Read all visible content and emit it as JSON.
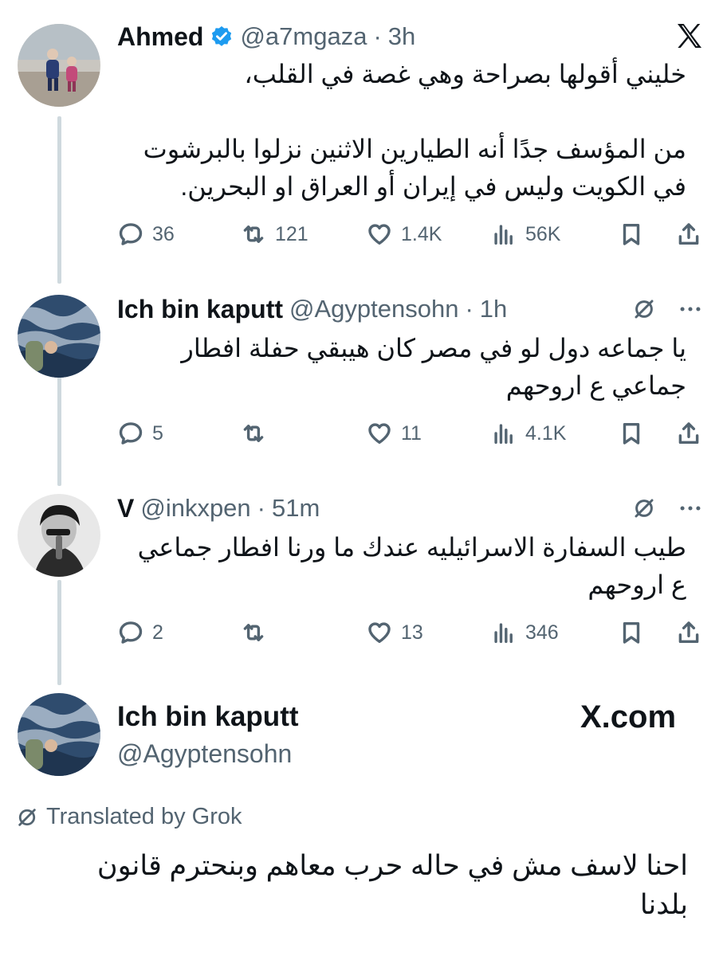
{
  "tweets": [
    {
      "name": "Ahmed",
      "handle": "@a7mgaza",
      "dot": "·",
      "time": "3h",
      "text": "خليني أقولها بصراحة وهي غصة في القلب،\n\nمن المؤسف جدًا أنه الطيارين الاثنين نزلوا بالبرشوت\nفي الكويت وليس في إيران أو العراق او البحرين.",
      "replies": "36",
      "reposts": "121",
      "likes": "1.4K",
      "views": "56K"
    },
    {
      "name": "Ich bin kaputt",
      "handle": "@Agyptensohn",
      "dot": "·",
      "time": "1h",
      "text": "يا جماعه دول لو في مصر كان هيبقي حفلة افطار\nجماعي ع اروحهم",
      "replies": "5",
      "reposts": "",
      "likes": "11",
      "views": "4.1K"
    },
    {
      "name": "V",
      "handle": "@inkxpen",
      "dot": "·",
      "time": "51m",
      "text": "طيب السفارة الاسرائيليه عندك ما ورنا افطار جماعي\nع اروحهم",
      "replies": "2",
      "reposts": "",
      "likes": "13",
      "views": "346"
    }
  ],
  "final": {
    "name": "Ich bin kaputt",
    "handle": "@Agyptensohn",
    "brand": "X.com",
    "translated_label": "Translated by Grok",
    "text": "احنا لاسف مش في حاله حرب معاهم وبنحترم قانون\nبلدنا"
  },
  "icons": {
    "top_right": "x-logo-icon",
    "grok": "grok-icon",
    "more": "more-icon"
  },
  "colors": {
    "verified": "#1d9bf0",
    "secondary_text": "#536471",
    "thread_line": "#cfd9de"
  }
}
